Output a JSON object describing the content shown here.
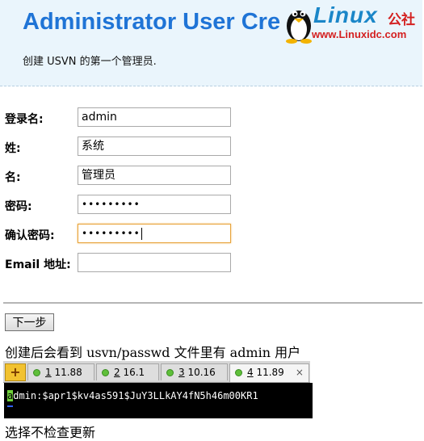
{
  "header": {
    "title": "Administrator User Cre",
    "subtitle": "创建 USVN 的第一个管理员."
  },
  "watermark": {
    "word": "Linux",
    "cn": "公社",
    "url": "www.Linuxidc.com"
  },
  "form": {
    "login": {
      "label": "登录名:",
      "value": "admin"
    },
    "surname": {
      "label": "姓:",
      "value": "系统"
    },
    "given": {
      "label": "名:",
      "value": "管理员"
    },
    "password": {
      "label": "密码:",
      "value": "•••••••••"
    },
    "confirm": {
      "label": "确认密码:",
      "value": "•••••••••"
    },
    "email": {
      "label": "Email 地址:",
      "value": ""
    }
  },
  "next_button": "下一步",
  "note": "创建后会看到 usvn/passwd 文件里有 admin 用户",
  "tabs": [
    {
      "num": "1",
      "label": " 11.88"
    },
    {
      "num": "2",
      "label": " 16.1"
    },
    {
      "num": "3",
      "label": " 10.16"
    },
    {
      "num": "4",
      "label": " 11.89"
    }
  ],
  "terminal": {
    "first_char": "a",
    "rest": "dmin:$apr1$kv4as591$JuY3LLkAY4fN5h46m00KR1"
  },
  "bottom_note": "选择不检查更新",
  "colors": {
    "title": "#1f74d6",
    "header_bg": "#eaf5fc",
    "tab_dot": "#5fbf3a"
  }
}
